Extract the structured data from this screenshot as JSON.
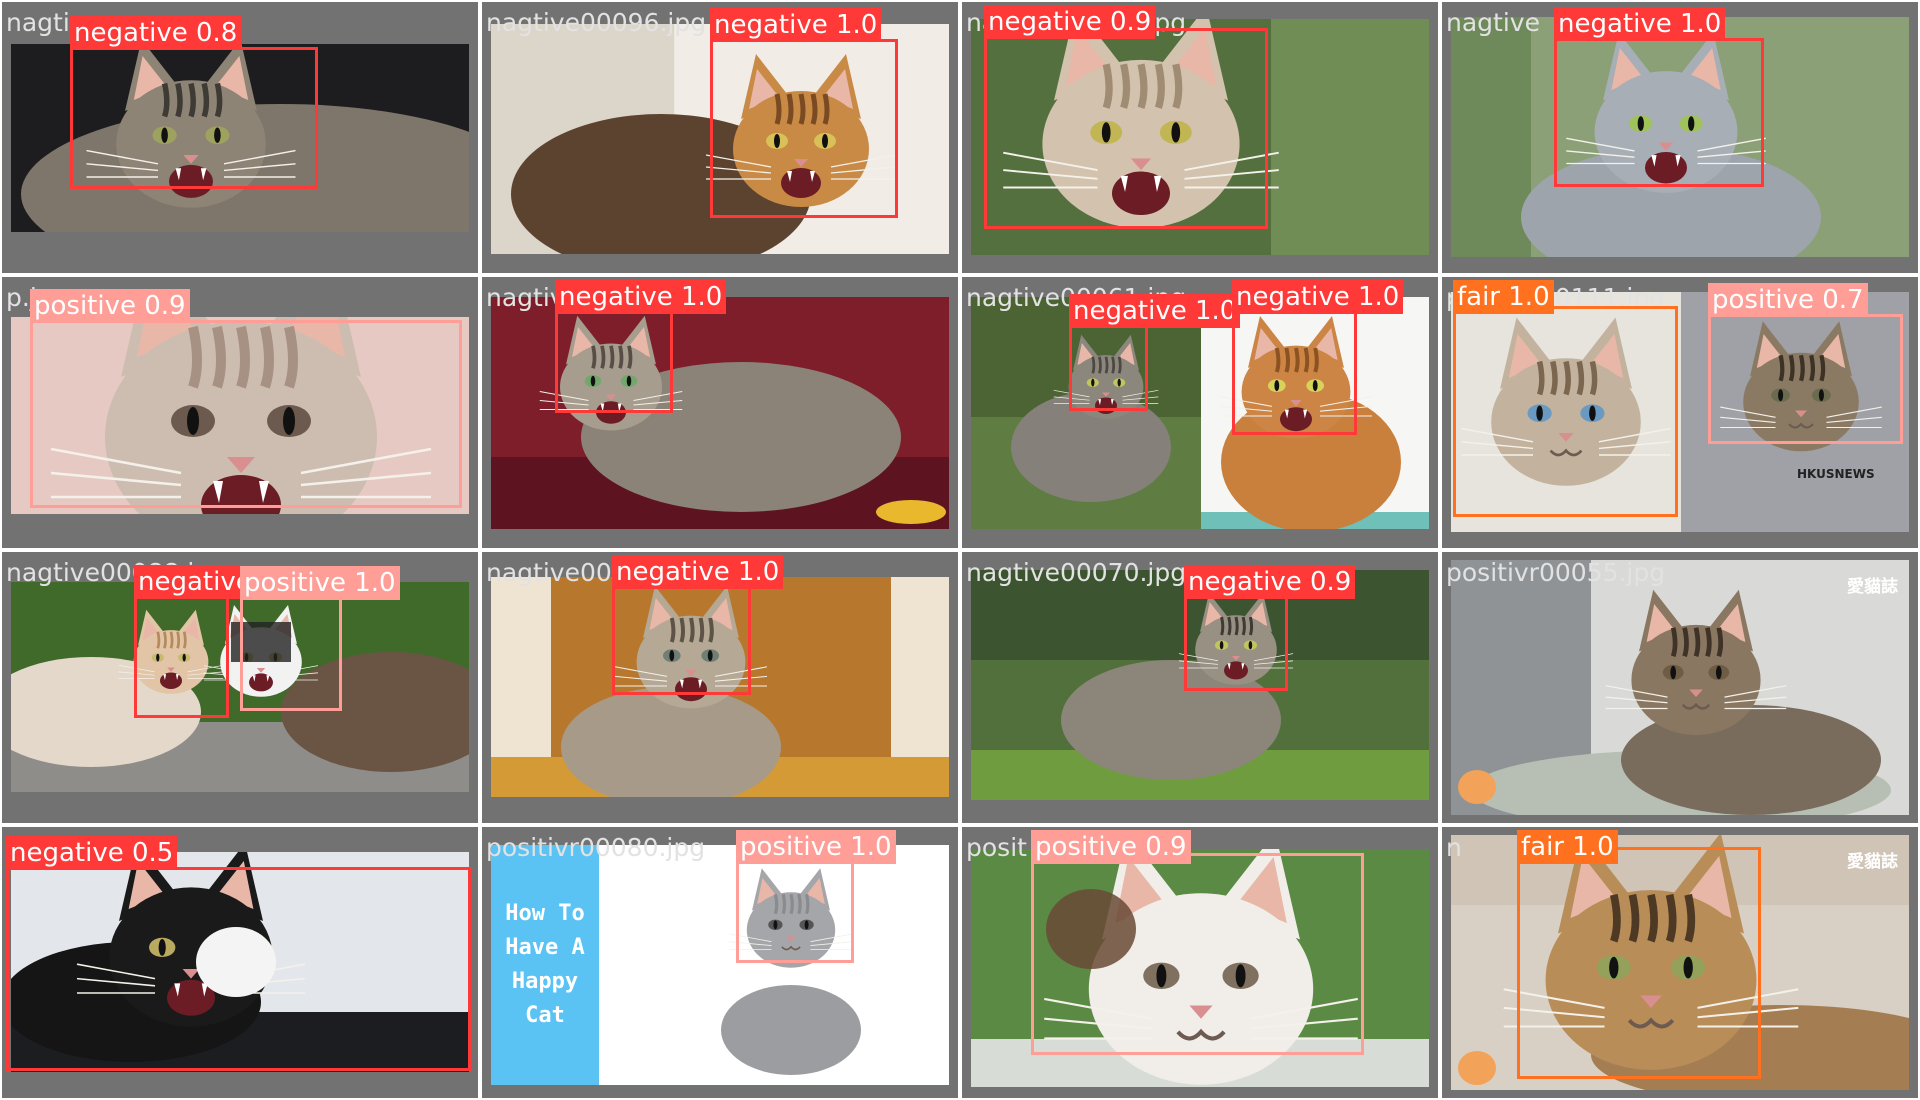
{
  "colors": {
    "negative": "#ff3838",
    "positive": "#ff9d97",
    "fair": "#ff701f"
  },
  "tiles": [
    {
      "filename": "nagtive",
      "photo_bg": "cat-gray-tabby",
      "boxes": [
        {
          "cls": "negative",
          "label": "negative 0.8"
        }
      ]
    },
    {
      "filename": "nagtive00096.jpg",
      "photo_bg": "cat-orange-on-white",
      "boxes": [
        {
          "cls": "negative",
          "label": "negative 1.0"
        }
      ]
    },
    {
      "filename": "nagtive00077.jpg",
      "photo_bg": "cat-cream-closeup",
      "boxes": [
        {
          "cls": "negative",
          "label": "negative 0.9"
        }
      ]
    },
    {
      "filename": "nagtive",
      "photo_bg": "cat-gray-garden",
      "boxes": [
        {
          "cls": "negative",
          "label": "negative 1.0"
        }
      ]
    },
    {
      "filename": "p.jpg",
      "photo_bg": "cat-nose-pink",
      "boxes": [
        {
          "cls": "positive",
          "label": "positive 0.9"
        }
      ]
    },
    {
      "filename": "nagtive00023.jpg",
      "photo_bg": "kitten-red-blanket",
      "boxes": [
        {
          "cls": "negative",
          "label": "negative 1.0"
        }
      ]
    },
    {
      "filename": "nagtive00061.jpg",
      "photo_bg": "two-cats-collage",
      "boxes": [
        {
          "cls": "negative",
          "label": "negative 1.0"
        },
        {
          "cls": "negative",
          "label": "negative 1.0"
        }
      ]
    },
    {
      "filename": "positivr00111.jpg",
      "photo_bg": "two-tabbies-collage",
      "boxes": [
        {
          "cls": "fair",
          "label": "fair 1.0"
        },
        {
          "cls": "positive",
          "label": "positive 0.7"
        }
      ],
      "watermark": "HKUSNEWS"
    },
    {
      "filename": "nagtive00088.jpg",
      "photo_bg": "two-cats-fighting",
      "boxes": [
        {
          "cls": "negative",
          "label": "negative 0.9"
        },
        {
          "cls": "positive",
          "label": "positive 1.0"
        }
      ]
    },
    {
      "filename": "nagtive00026.jpg",
      "photo_bg": "kitten-wooden-house",
      "boxes": [
        {
          "cls": "negative",
          "label": "negative 1.0"
        }
      ]
    },
    {
      "filename": "nagtive00070.jpg",
      "photo_bg": "tabby-walking-grass",
      "boxes": [
        {
          "cls": "negative",
          "label": "negative 0.9"
        }
      ]
    },
    {
      "filename": "positivr00055.jpg",
      "photo_bg": "kitten-sleeping-blanket",
      "boxes": [],
      "watermark": "愛貓誌"
    },
    {
      "filename": "9.jpg",
      "photo_bg": "black-white-cat",
      "boxes": [
        {
          "cls": "negative",
          "label": "negative 0.5"
        }
      ]
    },
    {
      "filename": "positivr00080.jpg",
      "photo_bg": "gray-cat-white-bg",
      "boxes": [
        {
          "cls": "positive",
          "label": "positive 1.0"
        }
      ],
      "banner_lines": [
        "How To",
        "Have A",
        "Happy",
        "Cat"
      ]
    },
    {
      "filename": "posit",
      "photo_bg": "white-cat-smiling",
      "boxes": [
        {
          "cls": "positive",
          "label": "positive 0.9"
        }
      ]
    },
    {
      "filename": "n",
      "photo_bg": "tabby-lying-closeup",
      "boxes": [
        {
          "cls": "fair",
          "label": "fair 1.0"
        }
      ],
      "watermark": "愛貓誌"
    }
  ]
}
